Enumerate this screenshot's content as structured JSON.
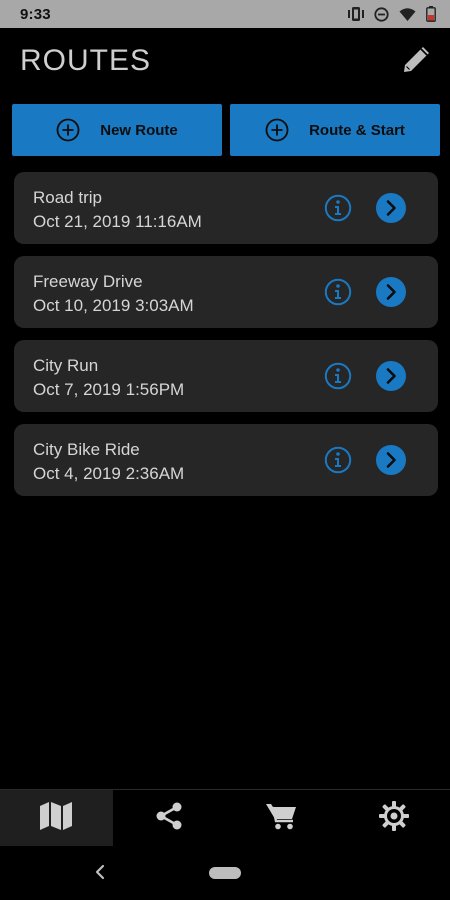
{
  "status_bar": {
    "time": "9:33",
    "icons": [
      "vibrate-icon",
      "do-not-disturb-icon",
      "wifi-icon",
      "battery-icon"
    ]
  },
  "header": {
    "title": "ROUTES",
    "edit_icon": "pencil-icon"
  },
  "actions": {
    "new_route_label": "New Route",
    "route_start_label": "Route & Start"
  },
  "routes": [
    {
      "name": "Road trip",
      "date": "Oct 21, 2019 11:16AM"
    },
    {
      "name": "Freeway Drive",
      "date": "Oct 10, 2019 3:03AM"
    },
    {
      "name": "City Run",
      "date": "Oct 7, 2019 1:56PM"
    },
    {
      "name": "City Bike Ride",
      "date": "Oct 4, 2019 2:36AM"
    }
  ],
  "bottom_nav": {
    "items": [
      "map-icon",
      "share-icon",
      "cart-icon",
      "settings-gear-icon"
    ],
    "active": "map-icon"
  },
  "colors": {
    "accent": "#1a79c3",
    "background": "#000000",
    "card": "#262626",
    "status_bar": "#a8a8a8"
  }
}
